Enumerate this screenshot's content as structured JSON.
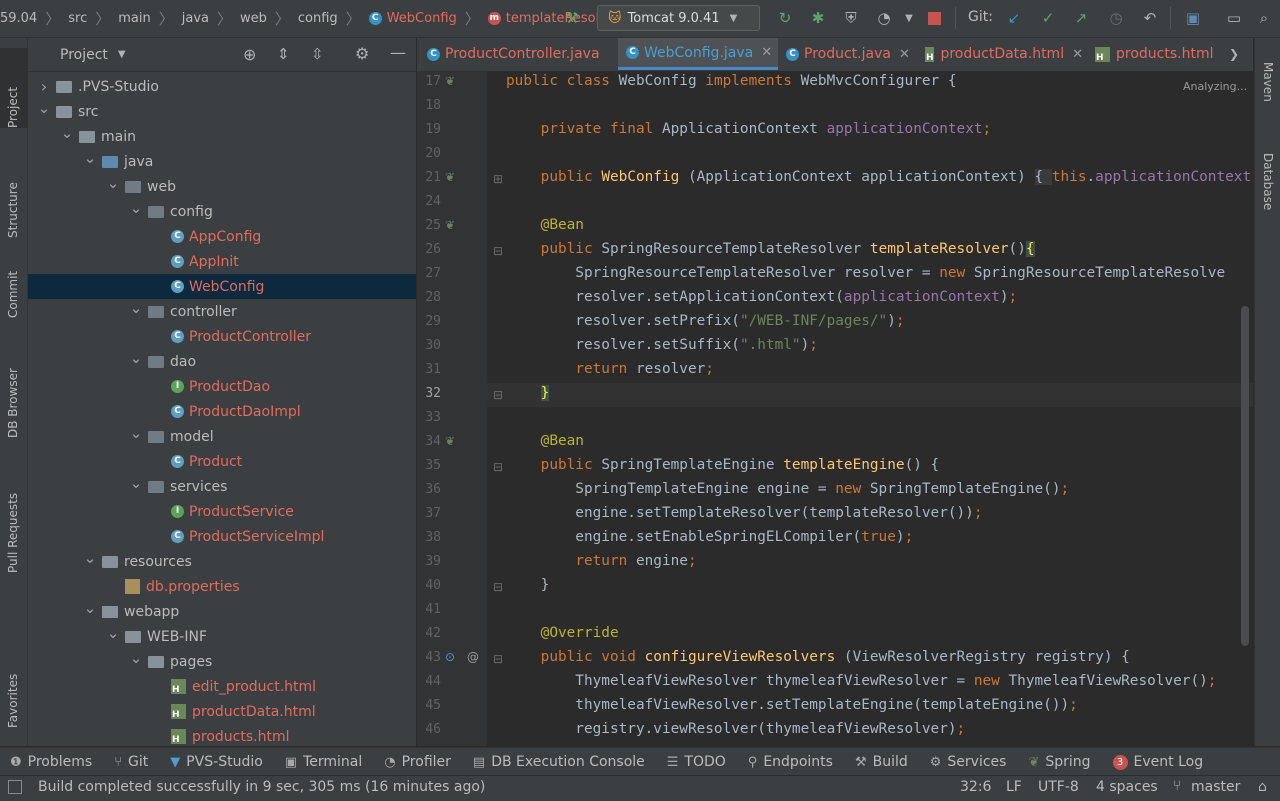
{
  "breadcrumb": {
    "items": [
      "59.04",
      "src",
      "main",
      "java",
      "web",
      "config",
      "WebConfig",
      "templateResolver"
    ]
  },
  "toolbar": {
    "run_config": "Tomcat 9.0.41",
    "git_label": "Git:"
  },
  "project_panel": {
    "title": "Project",
    "tree": [
      {
        "label": ".PVS-Studio",
        "depth": 1,
        "kind": "folder",
        "expanded": false
      },
      {
        "label": "src",
        "depth": 1,
        "kind": "folder",
        "expanded": true
      },
      {
        "label": "main",
        "depth": 2,
        "kind": "folder",
        "expanded": true
      },
      {
        "label": "java",
        "depth": 3,
        "kind": "folder-blue",
        "expanded": true
      },
      {
        "label": "web",
        "depth": 4,
        "kind": "package",
        "expanded": true
      },
      {
        "label": "config",
        "depth": 5,
        "kind": "package",
        "expanded": true
      },
      {
        "label": "AppConfig",
        "depth": 6,
        "kind": "class"
      },
      {
        "label": "AppInit",
        "depth": 6,
        "kind": "class"
      },
      {
        "label": "WebConfig",
        "depth": 6,
        "kind": "class",
        "selected": true
      },
      {
        "label": "controller",
        "depth": 5,
        "kind": "package",
        "expanded": true
      },
      {
        "label": "ProductController",
        "depth": 6,
        "kind": "class"
      },
      {
        "label": "dao",
        "depth": 5,
        "kind": "package",
        "expanded": true
      },
      {
        "label": "ProductDao",
        "depth": 6,
        "kind": "interface"
      },
      {
        "label": "ProductDaoImpl",
        "depth": 6,
        "kind": "class"
      },
      {
        "label": "model",
        "depth": 5,
        "kind": "package",
        "expanded": true
      },
      {
        "label": "Product",
        "depth": 6,
        "kind": "class"
      },
      {
        "label": "services",
        "depth": 5,
        "kind": "package",
        "expanded": true
      },
      {
        "label": "ProductService",
        "depth": 6,
        "kind": "interface"
      },
      {
        "label": "ProductServiceImpl",
        "depth": 6,
        "kind": "class"
      },
      {
        "label": "resources",
        "depth": 3,
        "kind": "folder",
        "expanded": true
      },
      {
        "label": "db.properties",
        "depth": 4,
        "kind": "properties"
      },
      {
        "label": "webapp",
        "depth": 3,
        "kind": "folder",
        "expanded": true
      },
      {
        "label": "WEB-INF",
        "depth": 4,
        "kind": "folder",
        "expanded": true
      },
      {
        "label": "pages",
        "depth": 5,
        "kind": "folder",
        "expanded": true
      },
      {
        "label": "edit_product.html",
        "depth": 6,
        "kind": "html"
      },
      {
        "label": "productData.html",
        "depth": 6,
        "kind": "html"
      },
      {
        "label": "products.html",
        "depth": 6,
        "kind": "html"
      }
    ]
  },
  "editor_tabs": [
    {
      "label": "ProductController.java",
      "kind": "class"
    },
    {
      "label": "WebConfig.java",
      "kind": "class",
      "active": true
    },
    {
      "label": "Product.java",
      "kind": "class"
    },
    {
      "label": "productData.html",
      "kind": "html"
    },
    {
      "label": "products.html",
      "kind": "html"
    }
  ],
  "editor": {
    "analyzing": "Analyzing...",
    "current_line": "32",
    "line_numbers": [
      "17",
      "18",
      "19",
      "20",
      "21",
      "24",
      "25",
      "26",
      "27",
      "28",
      "29",
      "30",
      "31",
      "32",
      "33",
      "34",
      "35",
      "36",
      "37",
      "38",
      "39",
      "40",
      "41",
      "42",
      "43",
      "44",
      "45",
      "46"
    ]
  },
  "left_tool_tabs": [
    "Project",
    "Structure",
    "Commit",
    "DB Browser",
    "Pull Requests",
    "Favorites"
  ],
  "right_tool_tabs": [
    "Maven",
    "Database"
  ],
  "bottom_tools": [
    "Problems",
    "Git",
    "PVS-Studio",
    "Terminal",
    "Profiler",
    "DB Execution Console",
    "TODO",
    "Endpoints",
    "Build",
    "Services",
    "Spring",
    "Event Log"
  ],
  "event_log_count": "3",
  "status": {
    "message": "Build completed successfully in 9 sec, 305 ms (16 minutes ago)",
    "position": "32:6",
    "line_sep": "LF",
    "encoding": "UTF-8",
    "indent": "4 spaces",
    "branch": "master"
  }
}
